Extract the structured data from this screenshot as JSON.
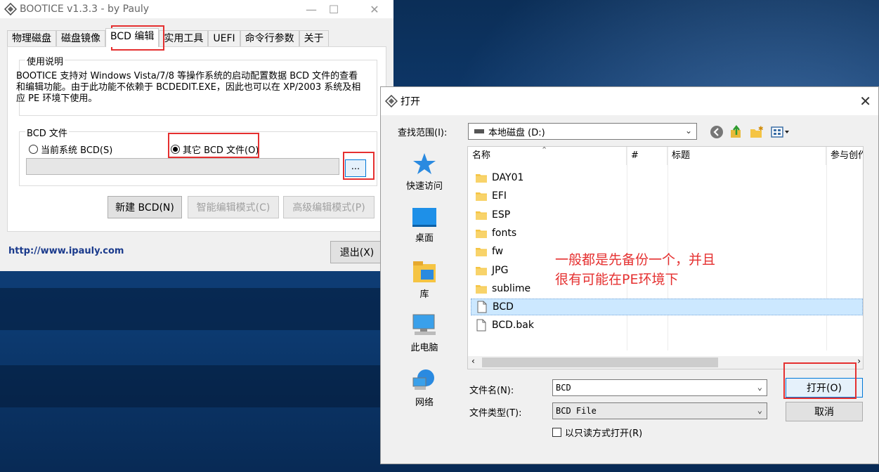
{
  "bootice": {
    "title": "BOOTICE v1.3.3 - by Pauly",
    "tabs": [
      {
        "label": "物理磁盘"
      },
      {
        "label": "磁盘镜像"
      },
      {
        "label": "BCD 编辑"
      },
      {
        "label": "实用工具"
      },
      {
        "label": "UEFI"
      },
      {
        "label": "命令行参数"
      },
      {
        "label": "关于"
      }
    ],
    "usage_group": "使用说明",
    "usage_text": "BOOTICE 支持对 Windows Vista/7/8 等操作系统的启动配置数据 BCD 文件的查看和编辑功能。由于此功能不依赖于 BCDEDIT.EXE，因此也可以在 XP/2003 系统及相应 PE 环境下使用。",
    "bcd_group": "BCD 文件",
    "radio_current": "当前系统 BCD(S)",
    "radio_other": "其它 BCD 文件(O)",
    "browse_label": "...",
    "btn_new": "新建 BCD(N)",
    "btn_smart": "智能编辑模式(C)",
    "btn_advanced": "高级编辑模式(P)",
    "link": "http://www.ipauly.com",
    "btn_exit": "退出(X)"
  },
  "dialog": {
    "title": "打开",
    "lookin_label": "查找范围(I):",
    "lookin_value": "本地磁盘 (D:)",
    "places": [
      {
        "label": "快速访问",
        "icon": "star-icon"
      },
      {
        "label": "桌面",
        "icon": "desktop-icon"
      },
      {
        "label": "库",
        "icon": "library-icon"
      },
      {
        "label": "此电脑",
        "icon": "computer-icon"
      },
      {
        "label": "网络",
        "icon": "network-icon"
      }
    ],
    "columns": [
      "名称",
      "#",
      "标题",
      "参与创作"
    ],
    "files": [
      {
        "name": "DAY01",
        "type": "folder"
      },
      {
        "name": "EFI",
        "type": "folder"
      },
      {
        "name": "ESP",
        "type": "folder"
      },
      {
        "name": "fonts",
        "type": "folder"
      },
      {
        "name": "fw",
        "type": "folder"
      },
      {
        "name": "JPG",
        "type": "folder"
      },
      {
        "name": "sublime",
        "type": "folder"
      },
      {
        "name": "BCD",
        "type": "file"
      },
      {
        "name": "BCD.bak",
        "type": "file"
      }
    ],
    "filename_label": "文件名(N):",
    "filename_value": "BCD",
    "filetype_label": "文件类型(T):",
    "filetype_value": "BCD File",
    "readonly_label": "以只读方式打开(R)",
    "btn_open": "打开(O)",
    "btn_cancel": "取消"
  },
  "annotation": {
    "line1": "一般都是先备份一个，并且",
    "line2": "很有可能在PE环境下"
  },
  "colors": {
    "highlight_red": "#e53030",
    "selection_blue": "#cce8ff",
    "folder_yellow": "#f5c443"
  }
}
